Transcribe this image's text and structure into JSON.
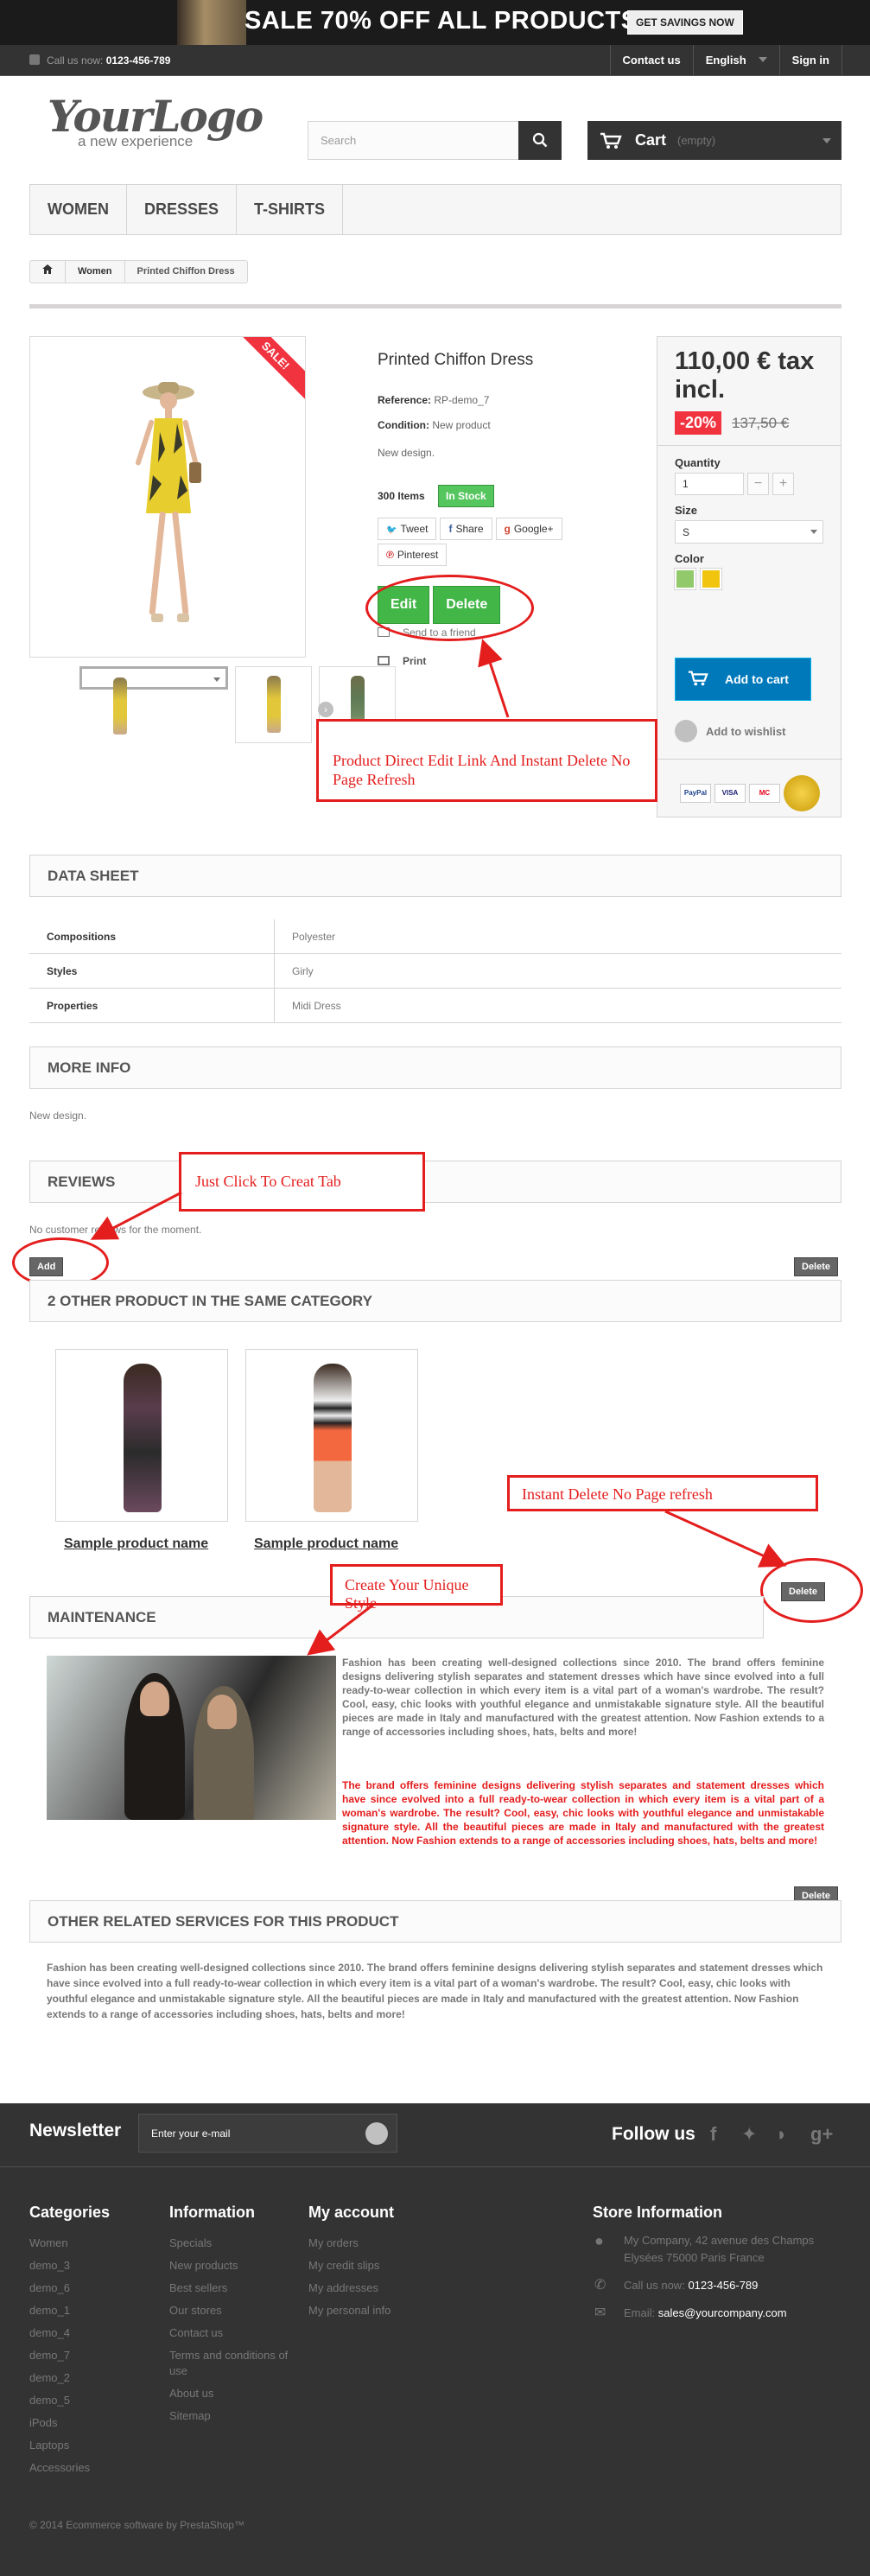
{
  "banner": {
    "sale_text": "SALE 70% OFF ALL PRODUCTS",
    "cta": "GET SAVINGS NOW"
  },
  "topnav": {
    "call_label": "Call us now:",
    "phone": "0123-456-789",
    "contact": "Contact us",
    "language": "English",
    "signin": "Sign in"
  },
  "header": {
    "logo_main": "YourLogo",
    "logo_sub": "a new experience",
    "search_placeholder": "Search",
    "cart_label": "Cart",
    "cart_status": "(empty)"
  },
  "menu": [
    "WOMEN",
    "DRESSES",
    "T-SHIRTS"
  ],
  "breadcrumb": [
    "Women",
    "Printed Chiffon Dress"
  ],
  "product": {
    "sale_flag": "SALE!",
    "title": "Printed Chiffon Dress",
    "reference_label": "Reference:",
    "reference": "RP-demo_7",
    "condition_label": "Condition:",
    "condition": "New product",
    "short_desc": "New design.",
    "items_count": "300 Items",
    "stock": "In Stock",
    "social": [
      "Tweet",
      "Share",
      "Google+",
      "Pinterest"
    ],
    "edit": "Edit",
    "delete": "Delete",
    "send_friend": "Send to a friend",
    "print": "Print"
  },
  "buybox": {
    "price": "110,00 € tax incl.",
    "discount": "-20%",
    "old_price": "137,50 €",
    "quantity_label": "Quantity",
    "quantity": "1",
    "size_label": "Size",
    "size": "S",
    "color_label": "Color",
    "colors": [
      "#91c96b",
      "#f1c40f"
    ],
    "add_to_cart": "Add to cart",
    "wishlist": "Add to wishlist",
    "payments": [
      "PayPal",
      "VISA",
      "MC"
    ]
  },
  "annotations": {
    "edit_delete": "Product Direct Edit Link And Instant Delete No Page Refresh",
    "create_tab": "Just Click To Creat Tab",
    "instant_delete": "Instant Delete No Page refresh",
    "unique_style": "Create Your Unique Style"
  },
  "datasheet": {
    "title": "DATA SHEET",
    "rows": [
      [
        "Compositions",
        "Polyester"
      ],
      [
        "Styles",
        "Girly"
      ],
      [
        "Properties",
        "Midi Dress"
      ]
    ]
  },
  "moreinfo": {
    "title": "MORE INFO",
    "text": "New design."
  },
  "reviews": {
    "title": "REVIEWS",
    "text": "No customer reviews for the moment.",
    "add": "Add",
    "delete": "Delete"
  },
  "related": {
    "title": "2 OTHER PRODUCT IN THE SAME CATEGORY",
    "products": [
      "Sample product name",
      "Sample product name"
    ],
    "delete": "Delete"
  },
  "maintenance": {
    "title": "MAINTENANCE",
    "text": "Fashion has been creating well-designed collections since 2010. The brand offers feminine designs delivering stylish separates and statement dresses which have since evolved into a full ready-to-wear collection in which every item is a vital part of a woman's wardrobe. The result? Cool, easy, chic looks with youthful elegance and unmistakable signature style. All the beautiful pieces are made in Italy and manufactured with the greatest attention. Now Fashion extends to a range of accessories including shoes, hats, belts and more!",
    "red": "The brand offers feminine designs delivering stylish separates and statement dresses which have since evolved into a full ready-to-wear collection in which every item is a vital part of a woman's wardrobe. The result? Cool, easy, chic looks with youthful elegance and unmistakable signature style. All the beautiful pieces are made in Italy and manufactured with the greatest attention. Now Fashion extends to a range of accessories including shoes, hats, belts and more!",
    "delete": "Delete"
  },
  "services": {
    "title": "OTHER RELATED SERVICES FOR THIS PRODUCT",
    "text": "Fashion has been creating well-designed collections since 2010. The brand offers feminine designs delivering stylish separates and statement dresses which have since evolved into a full ready-to-wear collection in which every item is a vital part of a woman's wardrobe. The result? Cool, easy, chic looks with youthful elegance and unmistakable signature style. All the beautiful pieces are made in Italy and manufactured with the greatest attention. Now Fashion extends to a range of accessories including shoes, hats, belts and more!"
  },
  "newsletter": {
    "title": "Newsletter",
    "placeholder": "Enter your e-mail",
    "follow": "Follow us"
  },
  "footer": {
    "categories_title": "Categories",
    "categories": [
      "Women",
      "demo_3",
      "demo_6",
      "demo_1",
      "demo_4",
      "demo_7",
      "demo_2",
      "demo_5",
      "iPods",
      "Laptops",
      "Accessories"
    ],
    "info_title": "Information",
    "info": [
      "Specials",
      "New products",
      "Best sellers",
      "Our stores",
      "Contact us",
      "Terms and conditions of use",
      "About us",
      "Sitemap"
    ],
    "account_title": "My account",
    "account": [
      "My orders",
      "My credit slips",
      "My addresses",
      "My personal info"
    ],
    "store_title": "Store Information",
    "address": "My Company, 42 avenue des Champs Elysées 75000 Paris France",
    "call_label": "Call us now:",
    "phone": "0123-456-789",
    "email_label": "Email:",
    "email": "sales@yourcompany.com",
    "copyright": "© 2014 Ecommerce software by PrestaShop™"
  }
}
